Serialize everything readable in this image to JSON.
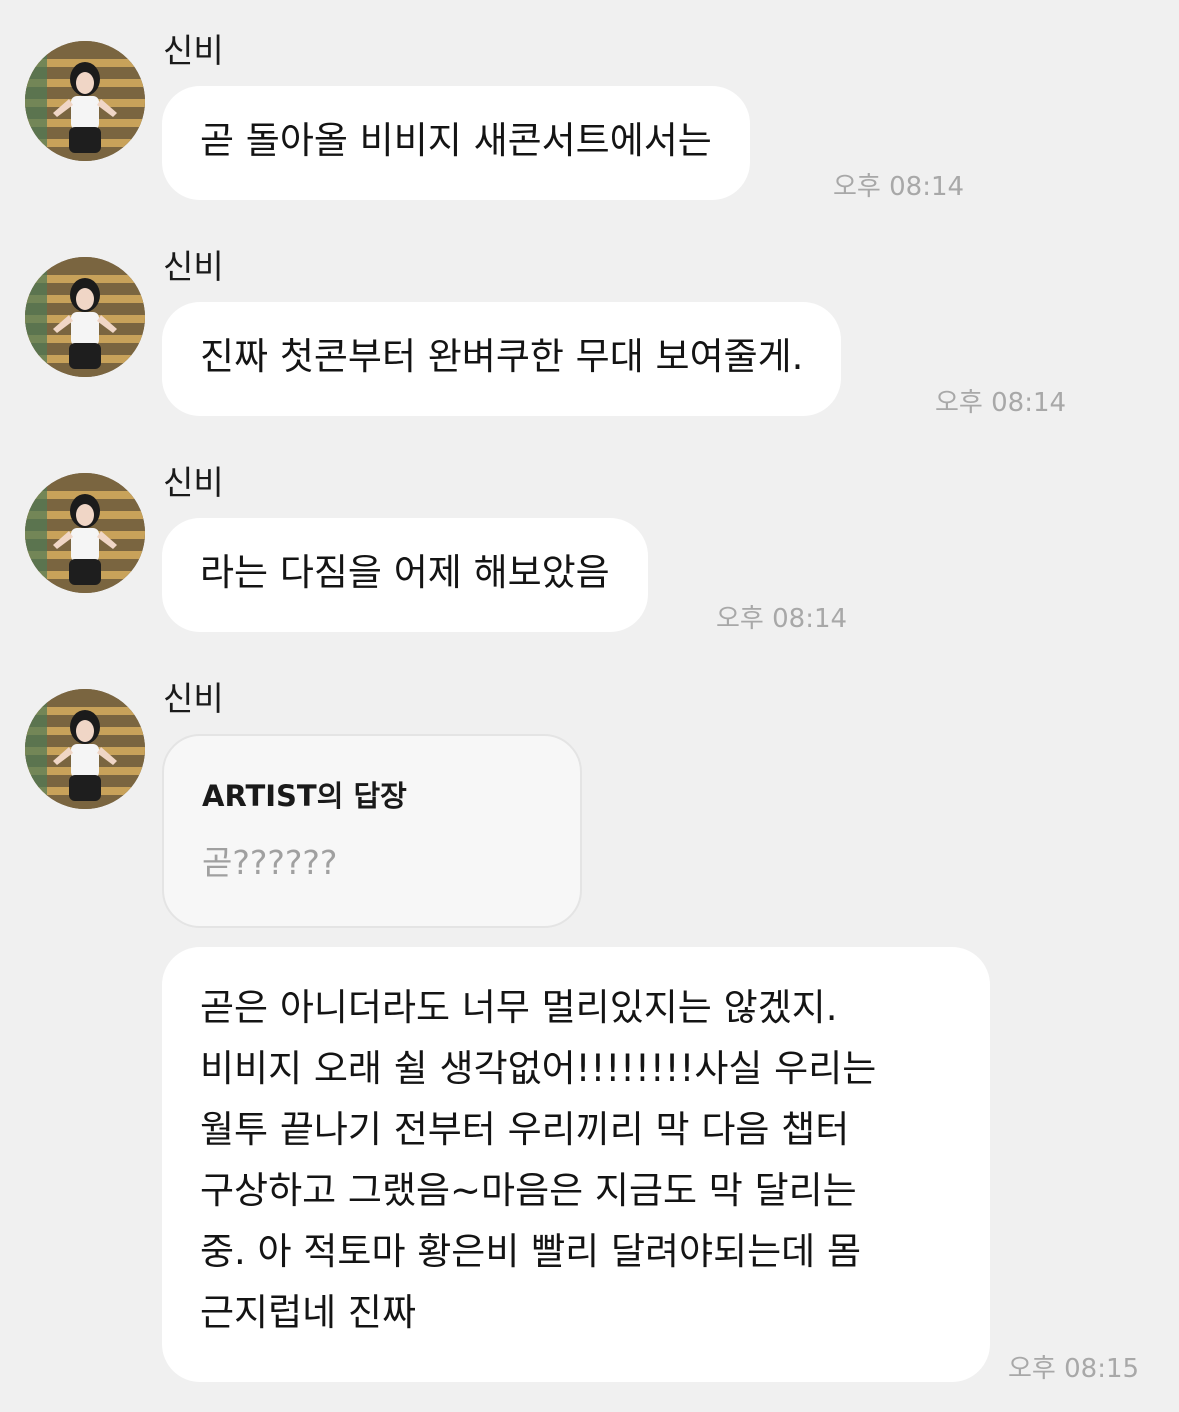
{
  "messages": [
    {
      "sender": "신비",
      "text": "곧 돌아올 비비지 새콘서트에서는",
      "time": "오후 08:14"
    },
    {
      "sender": "신비",
      "text": "진짜 첫콘부터 완벼쿠한 무대 보여줄게.",
      "time": "오후 08:14"
    },
    {
      "sender": "신비",
      "text": "라는 다짐을 어제 해보았음",
      "time": "오후 08:14"
    },
    {
      "sender": "신비",
      "reply": {
        "title": "ARTIST의 답장",
        "quoted": "곧??????"
      },
      "lines": [
        "곧은 아니더라도 너무 멀리있지는 않겠지.",
        "비비지 오래 쉴 생각없어!!!!!!!!사실 우리는",
        "월투 끝나기 전부터 우리끼리 막 다음 챕터",
        "구상하고 그랬음~마음은 지금도 막 달리는",
        "중. 아 적토마 황은비 빨리 달려야되는데 몸",
        "근지럽네 진짜"
      ],
      "time": "오후 08:15"
    }
  ],
  "colors": {
    "background": "#f0f0f0",
    "bubble": "#ffffff",
    "timestamp": "#a8a8a8",
    "reply_card": "#f7f7f7"
  },
  "icons": {
    "avatar": "profile-photo"
  }
}
